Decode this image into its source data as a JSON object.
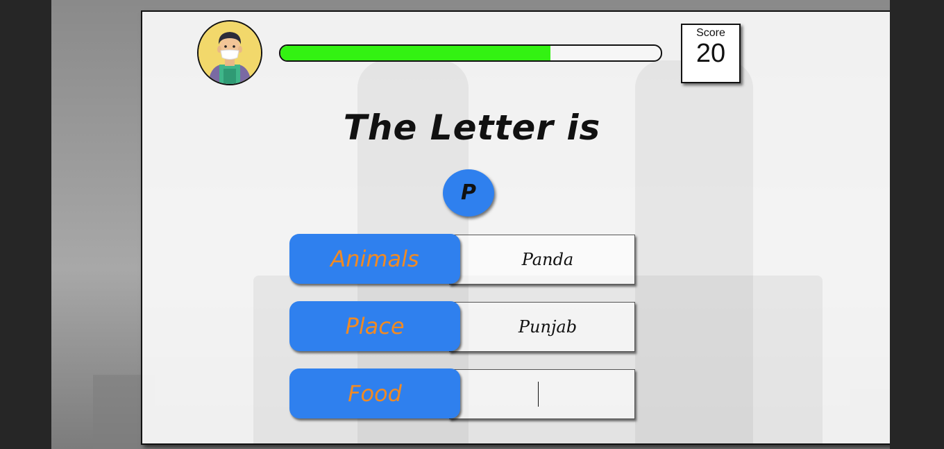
{
  "game": {
    "heading": "The Letter is",
    "letter": "P",
    "progress_fraction": 0.71
  },
  "score": {
    "label": "Score",
    "value": "20"
  },
  "categories": [
    {
      "label": "Animals",
      "value": "Panda"
    },
    {
      "label": "Place",
      "value": "Punjab"
    },
    {
      "label": "Food",
      "value": ""
    }
  ],
  "colors": {
    "progress_fill": "#33f212",
    "category_bg": "#2f80ee",
    "category_text": "#f08a24",
    "letter_bg": "#2f80ee"
  },
  "icons": {
    "avatar": "player-avatar-icon"
  }
}
